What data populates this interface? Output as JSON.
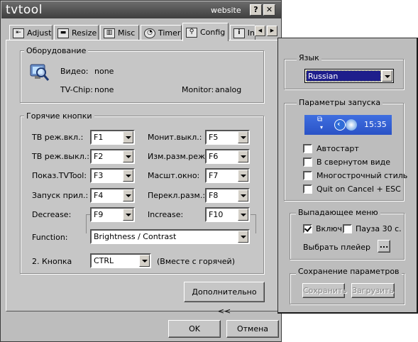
{
  "window": {
    "title": "tvtool",
    "website_label": "website",
    "help_glyph": "?",
    "close_glyph": "✕"
  },
  "tabs": [
    {
      "label": "Adjust",
      "icon": "adjust-icon",
      "glyph": "⇤"
    },
    {
      "label": "Resize",
      "icon": "resize-icon",
      "glyph": "▬"
    },
    {
      "label": "Misc",
      "icon": "misc-icon",
      "glyph": "▥"
    },
    {
      "label": "Timer",
      "icon": "timer-icon",
      "glyph": "◔"
    },
    {
      "label": "Config",
      "icon": "config-icon",
      "glyph": "⚲"
    },
    {
      "label": "In",
      "icon": "info-icon",
      "glyph": "i"
    }
  ],
  "tab_scroll": {
    "left": "◀",
    "right": "▶"
  },
  "hardware": {
    "title": "Оборудование",
    "video_label": "Видео:",
    "video_value": "none",
    "tvchip_label": "TV-Chip:",
    "tvchip_value": "none",
    "monitor_label": "Monitor:",
    "monitor_value": "analog"
  },
  "hotkeys": {
    "title": "Горячие кнопки",
    "rows": [
      {
        "left_label": "ТВ реж.вкл.:",
        "left_value": "F1",
        "right_label": "Монит.выкл.:",
        "right_value": "F5"
      },
      {
        "left_label": "ТВ реж.выкл.:",
        "left_value": "F2",
        "right_label": "Изм.разм.реж:",
        "right_value": "F6"
      },
      {
        "left_label": "Показ.TVTool:",
        "left_value": "F3",
        "right_label": "Масшт.окно:",
        "right_value": "F7"
      },
      {
        "left_label": "Запуск прил.:",
        "left_value": "F4",
        "right_label": "Перекл.разм.:",
        "right_value": "F8"
      },
      {
        "left_label": "Decrease:",
        "left_value": "F9",
        "right_label": "Increase:",
        "right_value": "F10"
      }
    ],
    "function_label": "Function:",
    "function_value": "Brightness / Contrast",
    "key2_label": "2. Кнопка",
    "key2_value": "CTRL",
    "key2_hint": "(Вместе с горячей)"
  },
  "advanced_button": "Дополнительно <<",
  "ok_button": "OK",
  "cancel_button": "Отмена",
  "right_panel": {
    "language": {
      "title": "Язык",
      "value": "Russian"
    },
    "startup": {
      "title": "Параметры запуска",
      "tray_time": "15:35",
      "options": [
        {
          "label": "Автостарт",
          "checked": false
        },
        {
          "label": "В свернутом виде",
          "checked": false
        },
        {
          "label": "Многострочный стиль",
          "checked": false
        },
        {
          "label": "Quit on Cancel + ESC",
          "checked": false
        }
      ]
    },
    "dropdown_menu": {
      "title": "Выпадающее меню",
      "enable_label": "Включ.",
      "enable_checked": true,
      "pause_label": "Пауза 30 с.",
      "pause_checked": false,
      "player_label": "Выбрать плейер",
      "player_button": "..."
    },
    "save_params": {
      "title": "Сохранение параметров",
      "save_button": "Сохранить",
      "load_button": "Загрузить"
    }
  }
}
